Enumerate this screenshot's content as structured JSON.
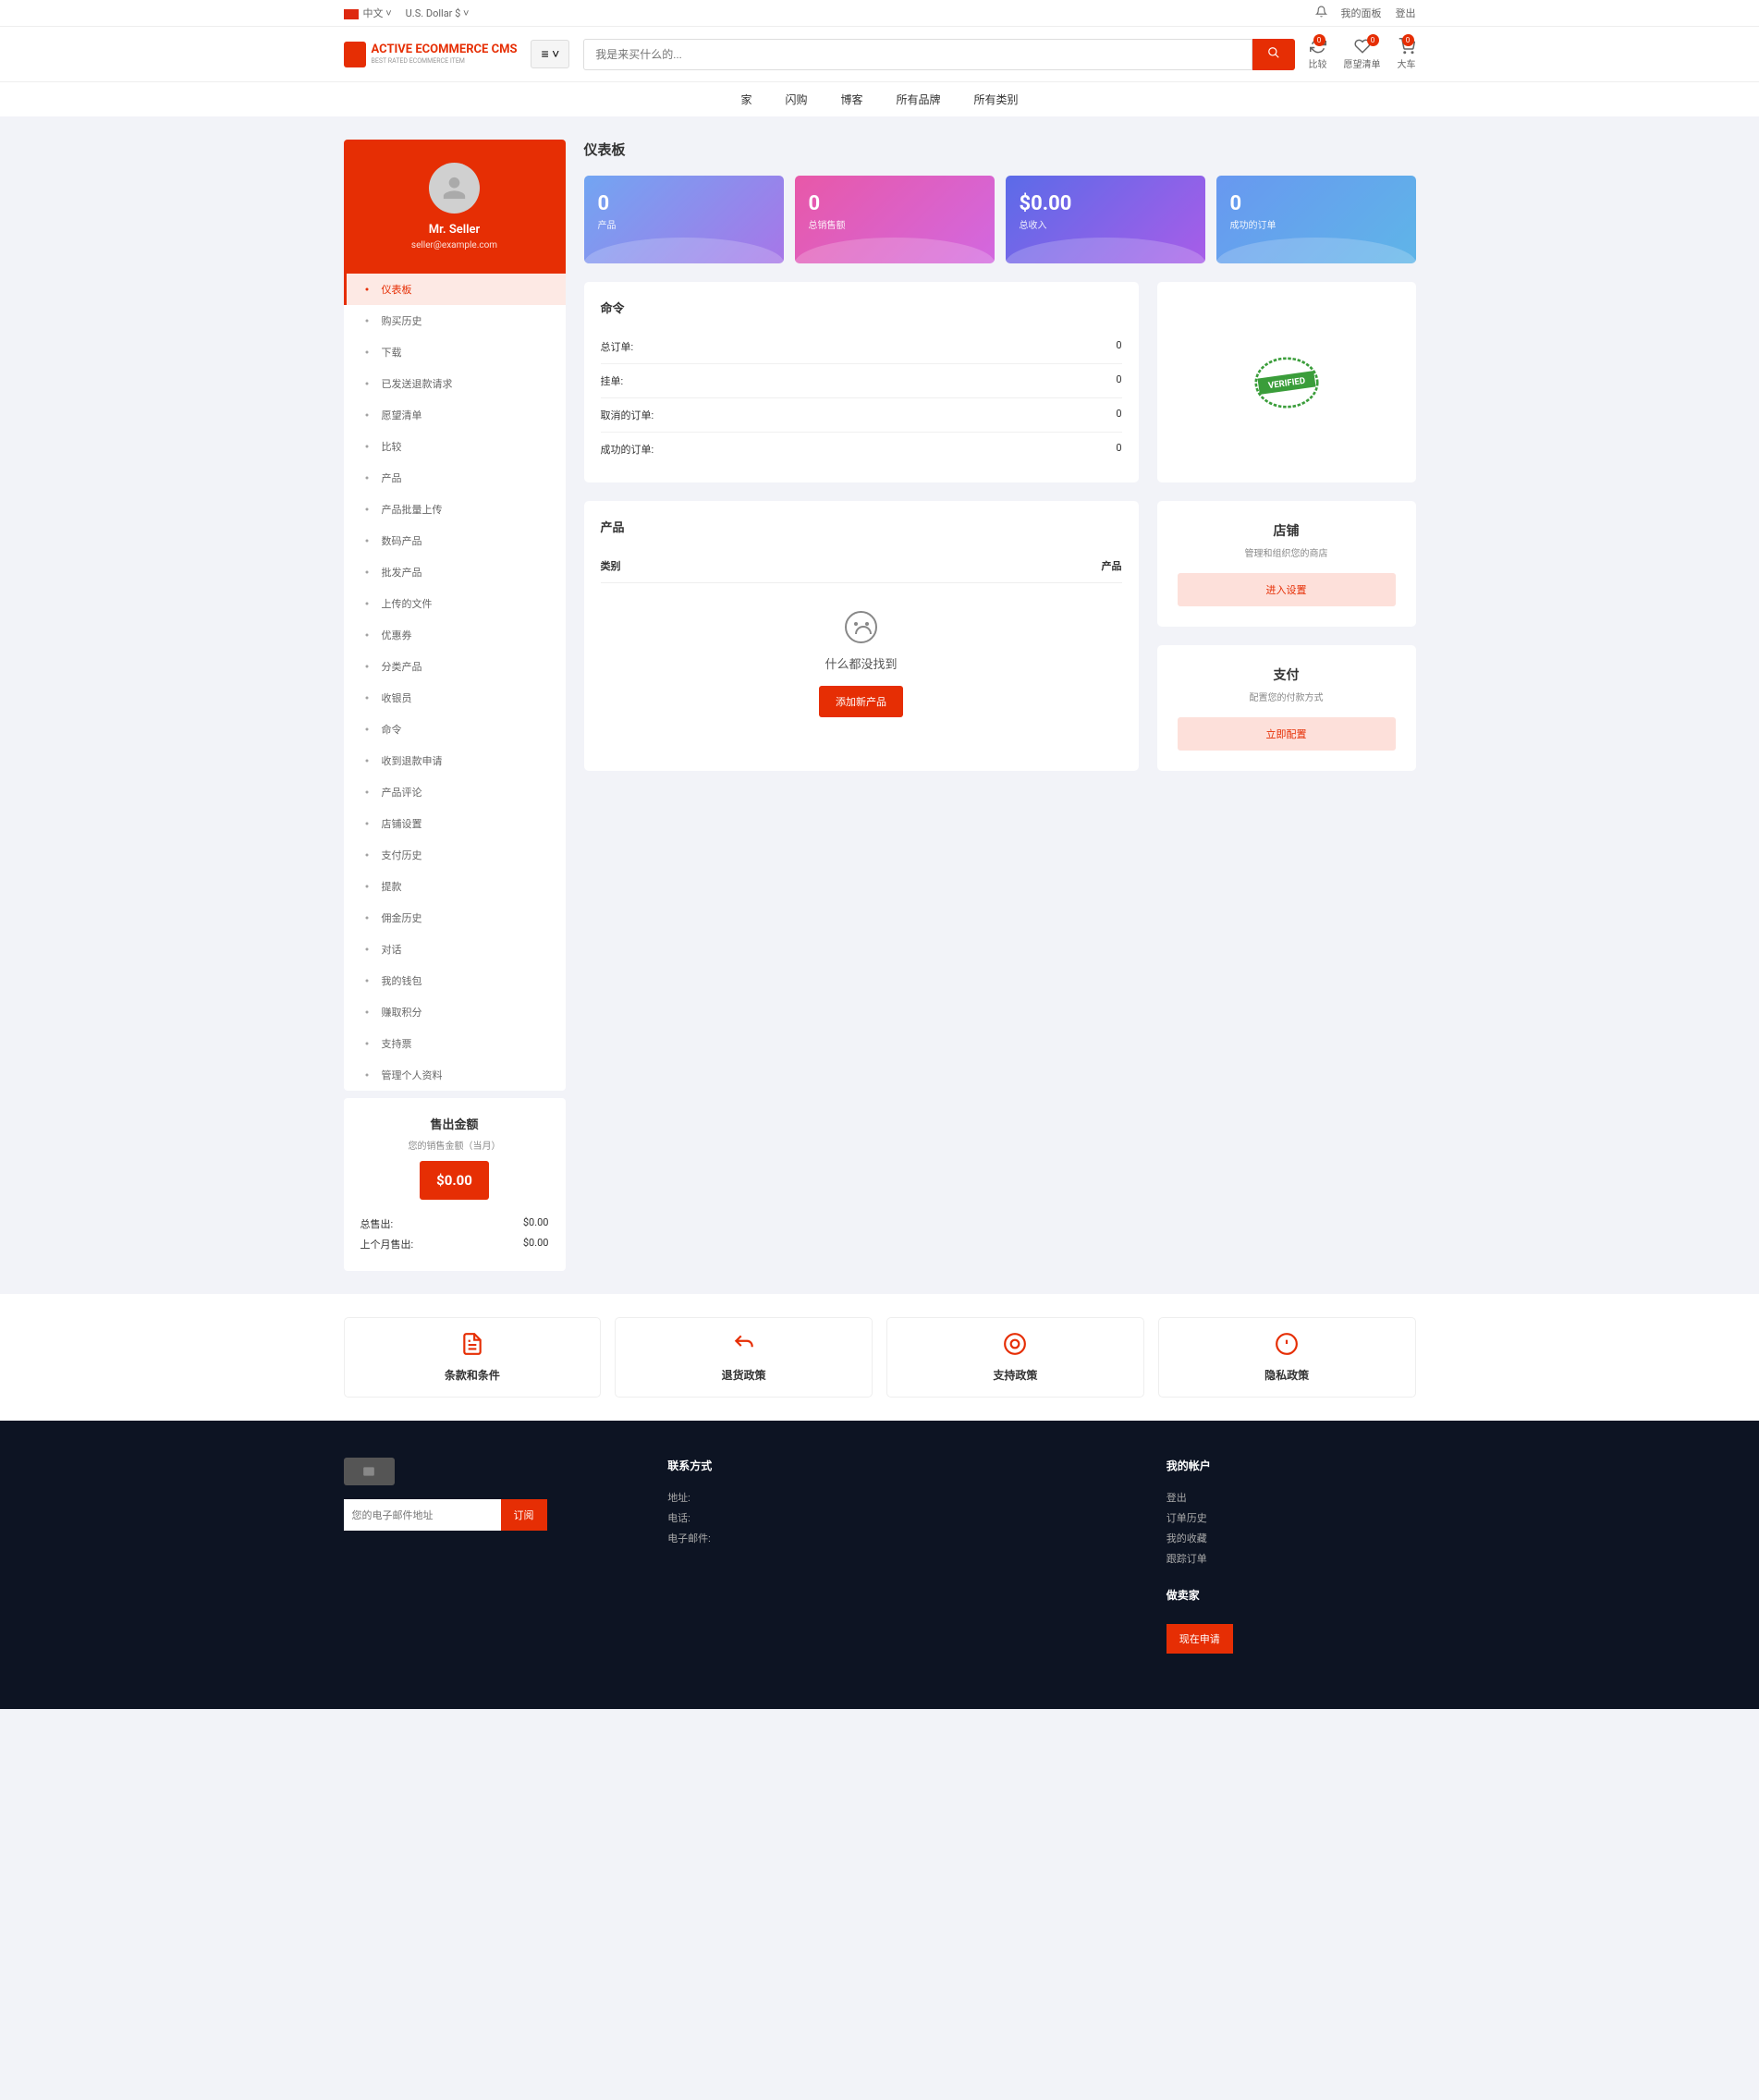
{
  "top": {
    "lang": "中文",
    "currency": "U.S. Dollar $",
    "panel": "我的面板",
    "logout": "登出"
  },
  "logo": {
    "main": "ACTIVE ECOMMERCE CMS",
    "sub": "BEST RATED ECOMMERCE ITEM"
  },
  "search": {
    "placeholder": "我是来买什么的..."
  },
  "headerLinks": {
    "compare": "比较",
    "wishlist": "愿望清单",
    "cart": "大车",
    "badge": "0"
  },
  "nav": [
    "家",
    "闪购",
    "博客",
    "所有品牌",
    "所有类别"
  ],
  "user": {
    "name": "Mr. Seller",
    "email": "seller@example.com"
  },
  "menu": [
    "仪表板",
    "购买历史",
    "下载",
    "已发送退款请求",
    "愿望清单",
    "比较",
    "产品",
    "产品批量上传",
    "数码产品",
    "批发产品",
    "上传的文件",
    "优惠券",
    "分类产品",
    "收银员",
    "命令",
    "收到退款申请",
    "产品评论",
    "店铺设置",
    "支付历史",
    "提款",
    "佣金历史",
    "对话",
    "我的钱包",
    "赚取积分",
    "支持票",
    "管理个人资料"
  ],
  "sales": {
    "title": "售出金额",
    "sub": "您的销售金额（当月）",
    "amount": "$0.00",
    "total_label": "总售出:",
    "total_val": "$0.00",
    "last_label": "上个月售出:",
    "last_val": "$0.00"
  },
  "pageTitle": "仪表板",
  "stats": [
    {
      "v": "0",
      "l": "产品"
    },
    {
      "v": "0",
      "l": "总销售额"
    },
    {
      "v": "$0.00",
      "l": "总收入"
    },
    {
      "v": "0",
      "l": "成功的订单"
    }
  ],
  "orders": {
    "title": "命令",
    "rows": [
      [
        "总订单:",
        "0"
      ],
      [
        "挂单:",
        "0"
      ],
      [
        "取消的订单:",
        "0"
      ],
      [
        "成功的订单:",
        "0"
      ]
    ]
  },
  "products": {
    "title": "产品",
    "col1": "类别",
    "col2": "产品",
    "empty": "什么都没找到",
    "btn": "添加新产品"
  },
  "shop": {
    "title": "店铺",
    "sub": "管理和组织您的商店",
    "btn": "进入设置"
  },
  "payment": {
    "title": "支付",
    "sub": "配置您的付款方式",
    "btn": "立即配置"
  },
  "policies": [
    "条款和条件",
    "退货政策",
    "支持政策",
    "隐私政策"
  ],
  "footer": {
    "contact": "联系方式",
    "addr": "地址:",
    "phone": "电话:",
    "email": "电子邮件:",
    "account": "我的帐户",
    "links": [
      "登出",
      "订单历史",
      "我的收藏",
      "跟踪订单"
    ],
    "seller": "做卖家",
    "apply": "现在申请",
    "sub_placeholder": "您的电子邮件地址",
    "sub_btn": "订阅"
  }
}
